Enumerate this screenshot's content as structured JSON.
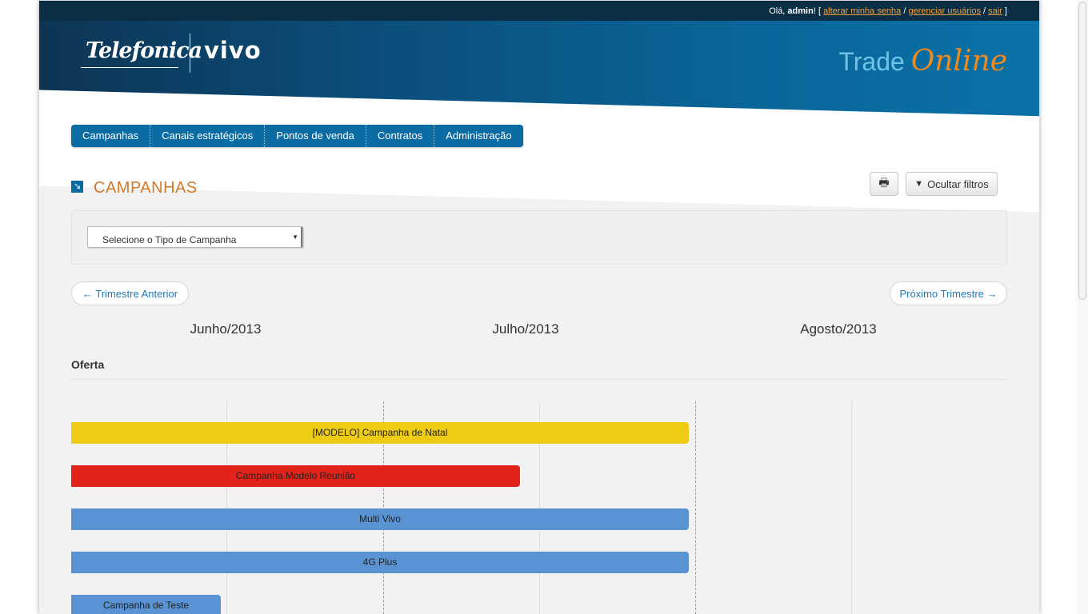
{
  "header": {
    "user_greeting": "Olá, ",
    "user_name": "admin",
    "user_exclaim": "! [ ",
    "link_change_password": "alterar minha senha",
    "sep1": " / ",
    "link_manage_users": "gerenciar usuários",
    "sep2": " / ",
    "link_logout": "sair",
    "close_bracket": " ]",
    "logo_telefonica": "Telefonica",
    "logo_vivo": "vivo",
    "brand_trade": "Trade",
    "brand_online": "Online"
  },
  "nav": {
    "items": [
      {
        "label": "Campanhas"
      },
      {
        "label": "Canais estratégicos"
      },
      {
        "label": "Pontos de venda"
      },
      {
        "label": "Contratos"
      },
      {
        "label": "Administração"
      }
    ]
  },
  "page": {
    "title_icon": "↘",
    "title": "CAMPANHAS",
    "print_icon": "🖶",
    "filter_icon": "▼",
    "hide_filters_label": "Ocultar filtros"
  },
  "filters": {
    "campaign_type_value": "Selecione o Tipo de Campanha"
  },
  "timeline": {
    "prev_quarter_label": "← Trimestre Anterior",
    "next_quarter_label": "Próximo Trimestre →",
    "months": [
      "Junho/2013",
      "Julho/2013",
      "Agosto/2013"
    ],
    "section_label": "Oferta",
    "campaigns": [
      {
        "name": "[MODELO] Campanha de Natal",
        "color": "#eecc14"
      },
      {
        "name": "Campanha Modelo Reunião",
        "color": "#e2231a"
      },
      {
        "name": "Multi Vivo",
        "color": "#5a93d3"
      },
      {
        "name": "4G Plus",
        "color": "#5a93d3"
      },
      {
        "name": "Campanha de Teste",
        "color": "#5a93d3"
      }
    ]
  },
  "colors": {
    "brand_blue": "#0b6ca3",
    "accent_orange": "#d4782a"
  }
}
